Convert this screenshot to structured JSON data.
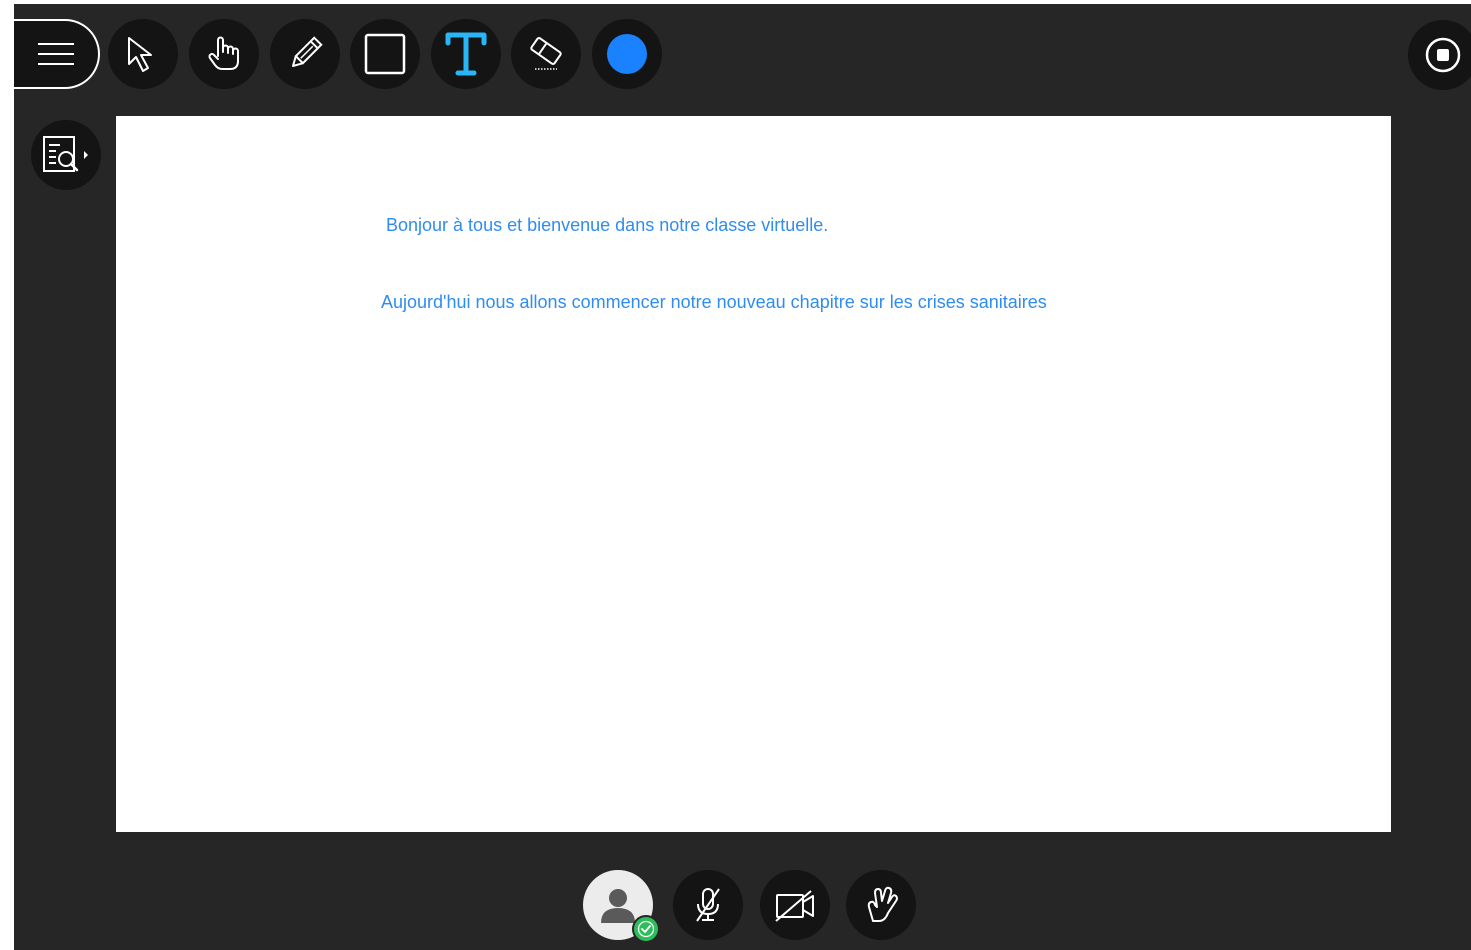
{
  "toolbar": {
    "tools": [
      {
        "name": "menu",
        "icon": "hamburger-icon"
      },
      {
        "name": "select",
        "icon": "arrow-pointer-icon"
      },
      {
        "name": "pan",
        "icon": "hand-pointer-icon"
      },
      {
        "name": "pencil",
        "icon": "pencil-icon"
      },
      {
        "name": "shape",
        "icon": "square-icon"
      },
      {
        "name": "text",
        "icon": "text-tool-icon"
      },
      {
        "name": "eraser",
        "icon": "eraser-icon"
      },
      {
        "name": "color",
        "icon": "color-swatch-icon"
      }
    ],
    "active_text_color": "#29b6f6",
    "selected_color": "#1a82ff",
    "stop": {
      "icon": "stop-share-icon"
    }
  },
  "side_panel": {
    "icon": "content-browser-icon"
  },
  "whiteboard": {
    "text_color": "#2f8cf0",
    "lines": [
      "Bonjour à tous et bienvenue dans notre classe virtuelle.",
      "Aujourd'hui nous allons commencer notre nouveau chapitre sur les crises sanitaires"
    ]
  },
  "bottom_bar": {
    "items": [
      {
        "name": "my-status",
        "icon": "avatar-icon",
        "badge_icon": "check-badge-icon",
        "badge_color": "#2dbd5a"
      },
      {
        "name": "microphone",
        "icon": "microphone-muted-icon"
      },
      {
        "name": "camera",
        "icon": "camera-off-icon"
      },
      {
        "name": "raise-hand",
        "icon": "raise-hand-icon"
      }
    ]
  }
}
